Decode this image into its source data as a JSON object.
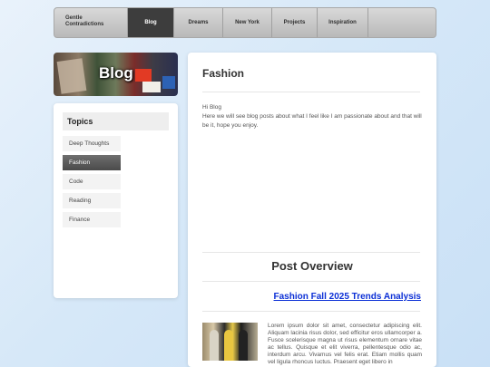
{
  "nav": {
    "brand_line1": "Gentle",
    "brand_line2": "Contradictions",
    "tabs": [
      {
        "label": "Blog"
      },
      {
        "label": "Dreams"
      },
      {
        "label": "New York"
      },
      {
        "label": "Projects"
      },
      {
        "label": "Inspiration"
      }
    ]
  },
  "sidebar": {
    "banner_title": "Blog",
    "topics_title": "Topics",
    "items": [
      {
        "label": "Deep Thoughts"
      },
      {
        "label": "Fashion"
      },
      {
        "label": "Code"
      },
      {
        "label": "Reading"
      },
      {
        "label": "Finance"
      }
    ],
    "active_index": 1
  },
  "main": {
    "heading": "Fashion",
    "intro_line1": "Hi Blog",
    "intro_line2": "Here we will see blog posts about what I feel like I am passionate about and that will be it, hope you enjoy.",
    "overview_title": "Post Overview",
    "post": {
      "title": "Fashion Fall 2025 Trends Analysis",
      "excerpt": "Lorem ipsum dolor sit amet, consectetur adipiscing elit. Aliquam lacinia risus dolor, sed efficitur eros ullamcorper a. Fusce scelerisque magna ut risus elementum ornare vitae ac tellus. Quisque et elit viverra, pellentesque odio ac, interdum arcu. Vivamus vel felis erat. Etiam mollis quam vel ligula rhoncus luctus. Praesent eget libero in"
    }
  },
  "colors": {
    "active_tab": "#3d3d3d",
    "link": "#0b2fd6"
  }
}
